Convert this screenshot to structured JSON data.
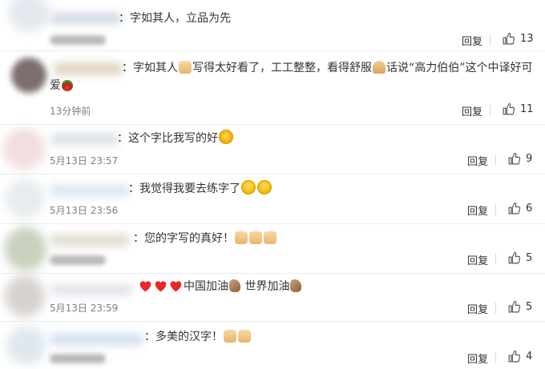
{
  "actions": {
    "reply_label": "回复"
  },
  "comments": [
    {
      "text": "：字如其人，立品为先",
      "time": "",
      "likes": "13"
    },
    {
      "text_line1": "：字如其人",
      "text_line1b": "写得太好看了，工工整整，看得舒服",
      "text_line1c": "话说“高力伯伯”这个中译好可",
      "text_line2": "爱",
      "time": "13分钟前",
      "likes": "11"
    },
    {
      "text": "：这个字比我写的好",
      "time": "5月13日 23:57",
      "likes": "9"
    },
    {
      "text": "：我觉得我要去练字了",
      "time": "5月13日 23:56",
      "likes": "6"
    },
    {
      "text": "：您的字写的真好！",
      "time": "",
      "likes": "5"
    },
    {
      "text_a": "中国加油",
      "text_b": "世界加油",
      "time": "5月13日 23:59",
      "likes": "5"
    },
    {
      "text": "：多美的汉字！",
      "time": "",
      "likes": "4"
    }
  ],
  "colors": {
    "divider": "#ebebeb",
    "text": "#333333",
    "muted": "#808080"
  },
  "icons": {
    "like": "thumbs-up-icon"
  }
}
